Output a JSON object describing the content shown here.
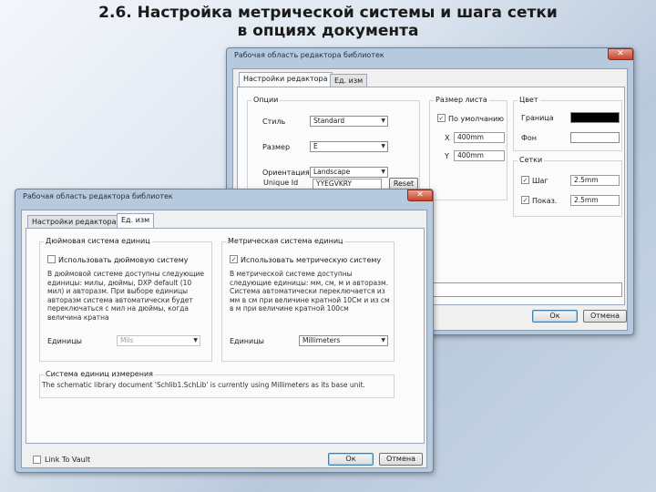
{
  "slide": {
    "title_line1": "2.6. Настройка метрической системы и шага сетки",
    "title_line2": "в опциях документа"
  },
  "back_window": {
    "title": "Рабочая область редактора библиотек",
    "close_glyph": "✕",
    "tabs": [
      "Настройки редактора",
      "Ед. изм"
    ],
    "options": {
      "label": "Опции",
      "style_label": "Стиль",
      "style_value": "Standard",
      "size_label": "Размер",
      "size_value": "E",
      "orientation_label": "Ориентация",
      "orientation_value": "Landscape",
      "unique_id_label": "Unique Id",
      "unique_id_value": "YYEGVKRY",
      "reset_label": "Reset"
    },
    "dimensions": {
      "label": "Размер листа",
      "default_label": "По умолчанию",
      "default_checked": true,
      "x_label": "X",
      "x_value": "400mm",
      "y_label": "Y",
      "y_value": "400mm"
    },
    "colors": {
      "label": "Цвет",
      "border_label": "Граница",
      "border_color": "#000000",
      "background_label": "Фон",
      "background_color": "#ffffff"
    },
    "grids": {
      "label": "Сетки",
      "snap_label": "Шаг",
      "snap_checked": true,
      "snap_value": "2.5mm",
      "visible_label": "Показ.",
      "visible_checked": true,
      "visible_value": "2.5mm"
    },
    "ok_label": "Ок",
    "cancel_label": "Отмена"
  },
  "front_window": {
    "title": "Рабочая область редактора библиотек",
    "close_glyph": "✕",
    "tabs": [
      "Настройки редактора",
      "Ед. изм"
    ],
    "imperial": {
      "label": "Дюймовая система единиц",
      "use_label": "Использовать дюймовую систему",
      "use_checked": false,
      "description": "В дюймовой системе доступны следующие единицы: милы, дюймы, DXP default (10 мил) и авторазм. При выборе единицы авторазм система автоматически будет переключаться с мил на дюймы, когда величина кратна",
      "units_label": "Единицы",
      "units_value": "Mils"
    },
    "metric": {
      "label": "Метрическая система единиц",
      "use_label": "Использовать метрическую систему",
      "use_checked": true,
      "description": "В метрической системе доступны следующие единицы: мм, см, м и авторазм. Система автоматически переключается из мм в см при величине кратной 10См и из см в м при величине кратной 100см",
      "units_label": "Единицы",
      "units_value": "Millimeters"
    },
    "unit_system": {
      "label": "Система единиц измерения",
      "text": "The schematic library document 'Schlib1.SchLib' is currently using Millimeters as its base unit."
    },
    "link_to_vault_label": "Link To Vault",
    "link_to_vault_checked": false,
    "ok_label": "Ок",
    "cancel_label": "Отмена"
  }
}
